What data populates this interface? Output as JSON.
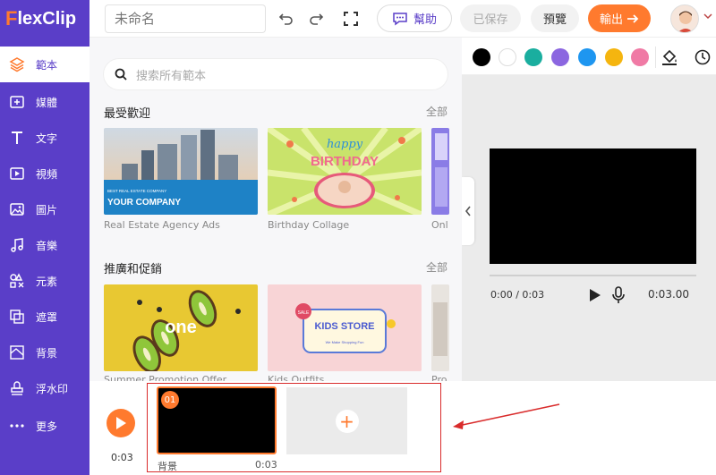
{
  "app": {
    "logo_initial": "F",
    "logo_rest": "lexClip"
  },
  "header": {
    "project_name_placeholder": "未命名",
    "help_label": "幫助",
    "saved_label": "已保存",
    "preview_label": "預覽",
    "export_label": "輸出",
    "accent_color": "#ff7a2e",
    "brand_color": "#5a3ec8"
  },
  "sidebar": {
    "items": [
      {
        "label": "範本",
        "icon": "layers-icon"
      },
      {
        "label": "媒體",
        "icon": "media-upload-icon"
      },
      {
        "label": "文字",
        "icon": "text-icon"
      },
      {
        "label": "視頻",
        "icon": "video-icon"
      },
      {
        "label": "圖片",
        "icon": "image-icon"
      },
      {
        "label": "音樂",
        "icon": "music-icon"
      },
      {
        "label": "元素",
        "icon": "elements-icon"
      },
      {
        "label": "遮罩",
        "icon": "overlay-icon"
      },
      {
        "label": "背景",
        "icon": "background-icon"
      },
      {
        "label": "浮水印",
        "icon": "watermark-icon"
      },
      {
        "label": "更多",
        "icon": "more-icon"
      }
    ]
  },
  "library": {
    "search_placeholder": "搜索所有範本",
    "sections": [
      {
        "title": "最受歡迎",
        "all_label": "全部",
        "items": [
          {
            "caption": "Real Estate Agency Ads",
            "overlay_small": "BEST REAL ESTATE COMPANY",
            "overlay_big": "YOUR COMPANY"
          },
          {
            "caption": "Birthday Collage",
            "overlay_small": "happy",
            "overlay_big": "BIRTHDAY"
          },
          {
            "caption": "Onl"
          }
        ]
      },
      {
        "title": "推廣和促銷",
        "all_label": "全部",
        "items": [
          {
            "caption": "Summer Promotion Offer",
            "overlay_big": "one"
          },
          {
            "caption": "Kids Outfits",
            "overlay_small": "SALE",
            "overlay_big": "KIDS STORE",
            "overlay_sub": "We Make Shopping Fun"
          },
          {
            "caption": "Pro"
          }
        ]
      }
    ]
  },
  "colors": [
    "#000000",
    "#ffffff",
    "#1aae9f",
    "#8b66e0",
    "#1e96f0",
    "#f5b50f",
    "#f07aa5"
  ],
  "player": {
    "current_time": "0:00",
    "total_time": "0:03",
    "elapsed_display": "0:03.00"
  },
  "timeline": {
    "time": "0:03",
    "scenes": [
      {
        "number": "01",
        "label": "背景",
        "duration": "0:03"
      }
    ],
    "add_symbol": "+"
  }
}
